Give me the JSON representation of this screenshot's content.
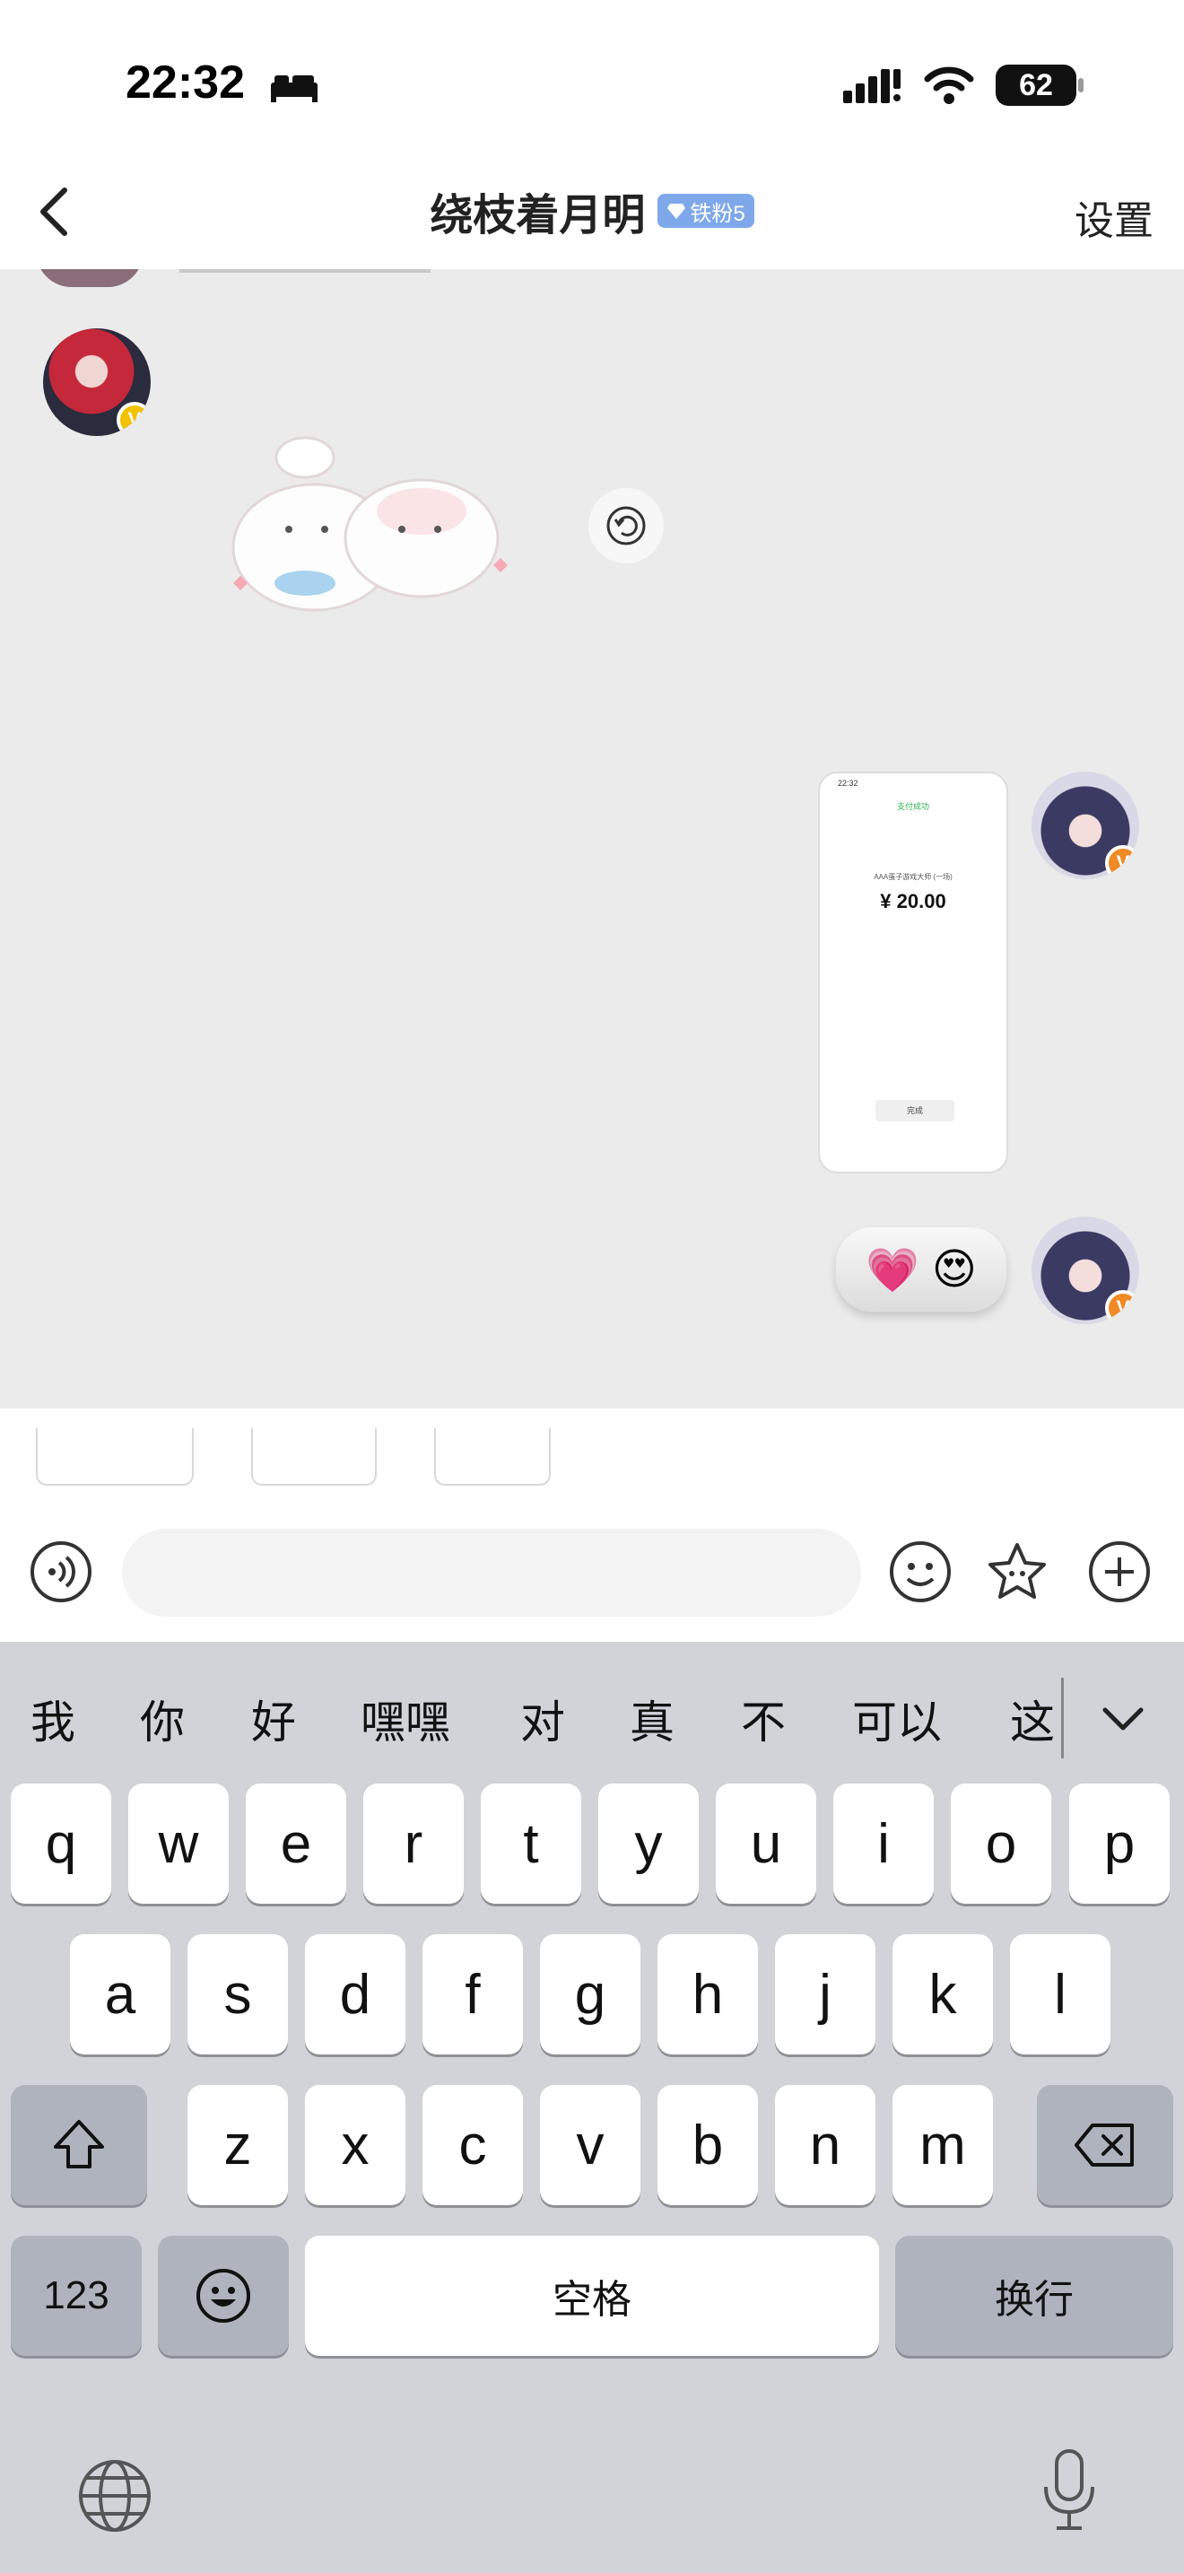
{
  "status_bar": {
    "time": "22:32",
    "battery": "62",
    "icons": [
      "sleep-icon",
      "signal-icon",
      "wifi-icon",
      "battery-icon"
    ]
  },
  "header": {
    "title": "绕枝着月明",
    "badge": "铁粉5",
    "settings_label": "设置",
    "back_icon": "chevron-left-icon"
  },
  "chat": {
    "messages": [
      {
        "side": "left",
        "type": "sticker",
        "sticker": "two-white-bunnies-sticker"
      },
      {
        "side": "right",
        "type": "image",
        "image": {
          "time": "22:32",
          "status": "支付成功",
          "desc": "AAA蛋子游戏大师 (一场)",
          "amount": "¥ 20.00",
          "done": "完成"
        }
      },
      {
        "side": "right",
        "type": "emoji",
        "emojis": [
          "💗",
          "😍"
        ]
      }
    ],
    "revoke_icon": "undo-circle-icon",
    "colors": {
      "verified_gold": "#f2c200",
      "verified_orange": "#f08a24"
    }
  },
  "input_bar": {
    "placeholder": "",
    "voice_icon": "voice-icon",
    "emoji_icon": "smile-icon",
    "sticker_icon": "star-face-icon",
    "plus_icon": "plus-circle-icon"
  },
  "keyboard": {
    "candidates": [
      "我",
      "你",
      "好",
      "嘿嘿",
      "对",
      "真",
      "不",
      "可以",
      "这"
    ],
    "row1": [
      "q",
      "w",
      "e",
      "r",
      "t",
      "y",
      "u",
      "i",
      "o",
      "p"
    ],
    "row2": [
      "a",
      "s",
      "d",
      "f",
      "g",
      "h",
      "j",
      "k",
      "l"
    ],
    "row3": [
      "z",
      "x",
      "c",
      "v",
      "b",
      "n",
      "m"
    ],
    "numbers_label": "123",
    "space_label": "空格",
    "return_label": "换行",
    "icons": [
      "shift-icon",
      "backspace-icon",
      "emoji-key-icon",
      "globe-icon",
      "microphone-icon",
      "chevron-down-icon"
    ]
  }
}
